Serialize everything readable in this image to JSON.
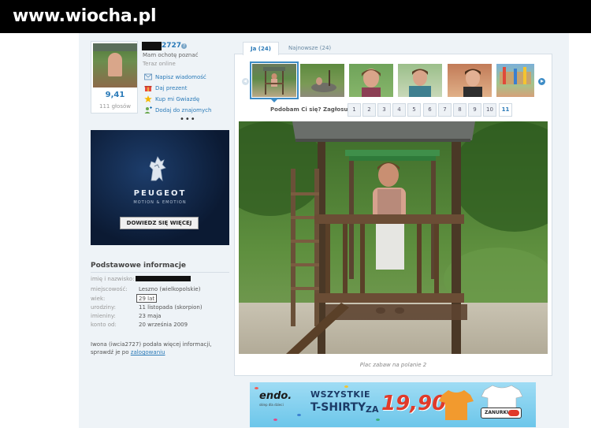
{
  "watermark": "www.wiocha.pl",
  "profile": {
    "username": "2727",
    "status_line": "Mam ochotę poznać",
    "online_status": "Teraz online",
    "score": "9,41",
    "votes": "111 głosów",
    "actions": [
      {
        "label": "Napisz wiadomość",
        "icon": "envelope-icon"
      },
      {
        "label": "Daj prezent",
        "icon": "gift-icon"
      },
      {
        "label": "Kup mi Gwiazdę",
        "icon": "star-icon"
      },
      {
        "label": "Dodaj do znajomych",
        "icon": "add-friend-icon"
      }
    ],
    "more": "•••"
  },
  "ad": {
    "brand": "PEUGEOT",
    "tagline": "MOTION & EMOTION",
    "button": "DOWIEDZ SIĘ WIĘCEJ"
  },
  "basic_info": {
    "title": "Podstawowe informacje",
    "rows": [
      {
        "label": "imię i nazwisko:",
        "value": ""
      },
      {
        "label": "miejscowość:",
        "value": "Leszno (wielkopolskie)"
      },
      {
        "label": "wiek:",
        "value": "29 lat"
      },
      {
        "label": "urodziny:",
        "value": "11 listopada (skorpion)"
      },
      {
        "label": "imieniny:",
        "value": "23 maja"
      },
      {
        "label": "konto od:",
        "value": "20 września 2009"
      }
    ],
    "desc_text": "Iwona (iwcia2727) podała więcej informacji, sprawdź je po",
    "desc_link": "zalogowaniu"
  },
  "gallery": {
    "tabs": [
      "Ja (24)",
      "Najnowsze (24)"
    ],
    "vote_label": "Podobam Ci się? Zagłosuj:",
    "vote_options": [
      "1",
      "2",
      "3",
      "4",
      "5",
      "6",
      "7",
      "8",
      "9",
      "10",
      "11"
    ],
    "caption": "Plac zabaw na polanie 2"
  },
  "banner": {
    "brand": "endo.",
    "brand_sub": "sklep dla dzieci",
    "line1": "WSZYSTKIE",
    "line2": "T-SHIRTY",
    "za": "ZA",
    "price": "19,90!",
    "button": "ZANURKUJ",
    "colors": {
      "bg": "#6cc6ea",
      "price": "#e03a2a"
    }
  }
}
